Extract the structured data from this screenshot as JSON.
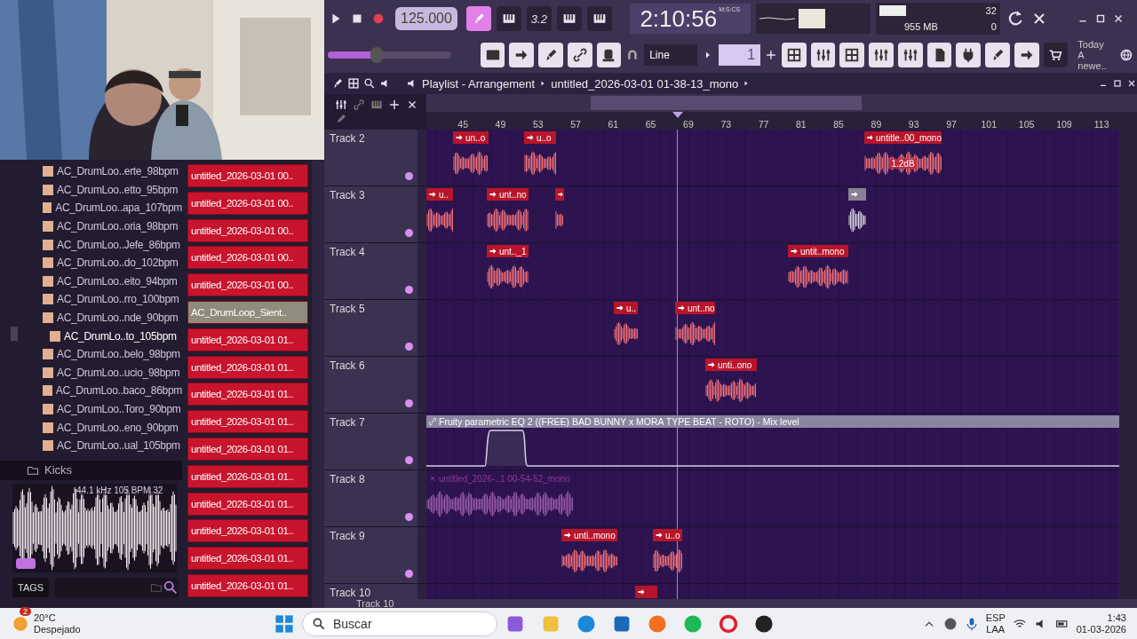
{
  "transport": {
    "tempo": "125.000",
    "pattern_length": "3.2",
    "time": "2:10:56",
    "time_format": "M:S:CS",
    "cpu": "32",
    "memory": "955 MB",
    "polyphony": "0"
  },
  "toolbar": {
    "master_volume": {
      "level": 0.4
    },
    "snap": "Line",
    "pattern": "1",
    "news": {
      "title": "Today",
      "text": "A newe.."
    }
  },
  "browser": {
    "items": [
      {
        "name": "AC_DrumLoo..erte_98bpm",
        "selected": false
      },
      {
        "name": "AC_DrumLoo..etto_95bpm",
        "selected": false
      },
      {
        "name": "AC_DrumLoo..apa_107bpm",
        "selected": false
      },
      {
        "name": "AC_DrumLoo..oria_98bpm",
        "selected": false
      },
      {
        "name": "AC_DrumLoo..Jefe_86bpm",
        "selected": false
      },
      {
        "name": "AC_DrumLoo..do_102bpm",
        "selected": false
      },
      {
        "name": "AC_DrumLoo..eito_94bpm",
        "selected": false
      },
      {
        "name": "AC_DrumLoo..rro_100bpm",
        "selected": false
      },
      {
        "name": "AC_DrumLoo..nde_90bpm",
        "selected": false
      },
      {
        "name": "AC_DrumLo..to_105bpm",
        "selected": true
      },
      {
        "name": "AC_DrumLoo..belo_98bpm",
        "selected": false
      },
      {
        "name": "AC_DrumLoo..ucio_98bpm",
        "selected": false
      },
      {
        "name": "AC_DrumLoo..baco_86bpm",
        "selected": false
      },
      {
        "name": "AC_DrumLoo..Toro_90bpm",
        "selected": false
      },
      {
        "name": "AC_DrumLoo..eno_90bpm",
        "selected": false
      },
      {
        "name": "AC_DrumLoo..ual_105bpm",
        "selected": false
      }
    ],
    "folder": "Kicks",
    "preview_info": "44.1 kHz 105 BPM 32",
    "tags": "TAGS"
  },
  "picker": [
    {
      "label": "untitled_2026-03-01 00..",
      "selected": false
    },
    {
      "label": "untitled_2026-03-01 00..",
      "selected": false
    },
    {
      "label": "untitled_2026-03-01 00..",
      "selected": false
    },
    {
      "label": "untitled_2026-03-01 00..",
      "selected": false
    },
    {
      "label": "untitled_2026-03-01 00..",
      "selected": false
    },
    {
      "label": "AC_DrumLoop_Sient..",
      "selected": true
    },
    {
      "label": "untitled_2026-03-01 01..",
      "selected": false
    },
    {
      "label": "untitled_2026-03-01 01..",
      "selected": false
    },
    {
      "label": "untitled_2026-03-01 01..",
      "selected": false
    },
    {
      "label": "untitled_2026-03-01 01..",
      "selected": false
    },
    {
      "label": "untitled_2026-03-01 01..",
      "selected": false
    },
    {
      "label": "untitled_2026-03-01 01..",
      "selected": false
    },
    {
      "label": "untitled_2026-03-01 01..",
      "selected": false
    },
    {
      "label": "untitled_2026-03-01 01..",
      "selected": false
    },
    {
      "label": "untitled_2026-03-01 01..",
      "selected": false
    },
    {
      "label": "untitled_2026-03-01 01..",
      "selected": false
    }
  ],
  "playlist": {
    "title": "Playlist - Arrangement",
    "pattern": "untitled_2026-03-01 01-38-13_mono",
    "ruler": [
      "45",
      "49",
      "53",
      "57",
      "61",
      "65",
      "69",
      "73",
      "77",
      "81",
      "85",
      "89",
      "93",
      "97",
      "101",
      "105",
      "109",
      "113"
    ],
    "tracks": [
      {
        "name": "Track 2",
        "clips": [
          {
            "kind": "audio",
            "label": "un..o"
          },
          {
            "kind": "audio",
            "label": "u..o"
          },
          {
            "kind": "audio",
            "label": "untitle..00_mono",
            "gain": "1.2dB"
          }
        ]
      },
      {
        "name": "Track 3",
        "clips": [
          {
            "kind": "audio",
            "label": "u.."
          },
          {
            "kind": "audio",
            "label": "unt..no"
          },
          {
            "kind": "audio"
          },
          {
            "kind": "grey"
          }
        ]
      },
      {
        "name": "Track 4",
        "clips": [
          {
            "kind": "audio",
            "label": "unt.._1"
          },
          {
            "kind": "audio",
            "label": "untit..mono"
          }
        ]
      },
      {
        "name": "Track 5",
        "clips": [
          {
            "kind": "audio",
            "label": "u.."
          },
          {
            "kind": "audio",
            "label": "unt..no"
          }
        ]
      },
      {
        "name": "Track 6",
        "clips": [
          {
            "kind": "audio",
            "label": "unti..ono"
          }
        ]
      },
      {
        "name": "Track 7",
        "clips": [
          {
            "kind": "automation",
            "label": "Fruity parametric EQ 2 ((FREE) BAD BUNNY x MORA TYPE BEAT - ROTO) - Mix level"
          }
        ]
      },
      {
        "name": "Track 8",
        "clips": [
          {
            "kind": "disabled",
            "label": "untitled_2026-..1 00-54-52_mono"
          }
        ]
      },
      {
        "name": "Track 9",
        "clips": [
          {
            "kind": "audio",
            "label": "unti..mono"
          },
          {
            "kind": "audio",
            "label": "u..o"
          }
        ]
      },
      {
        "name": "Track 10",
        "clips": [
          {
            "kind": "stub"
          }
        ]
      }
    ],
    "footer_track": "Track 10"
  },
  "taskbar": {
    "temperature": "20°C",
    "condition": "Despejado",
    "badge": "2",
    "search": "Buscar",
    "language": "ESP",
    "layout": "LAA",
    "time": "1:43",
    "date": "01-03-2026"
  }
}
